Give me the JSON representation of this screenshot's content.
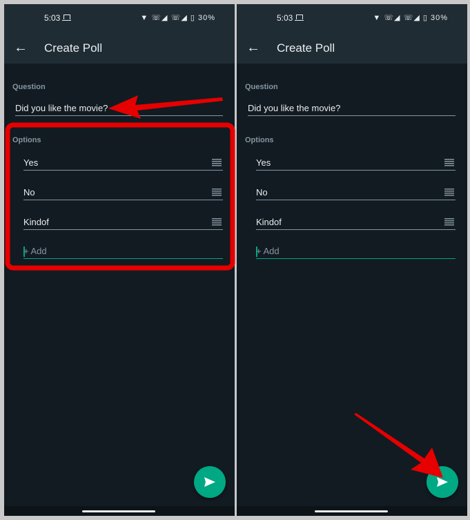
{
  "screens": [
    {
      "status": {
        "time": "5:03",
        "icons": "▼ ☏◢ ☏◢ ▯ ",
        "battery": "30%"
      },
      "header": {
        "title": "Create Poll",
        "back_icon": "arrow-left-icon"
      },
      "question": {
        "label": "Question",
        "value": "Did you like the movie?"
      },
      "options": {
        "label": "Options",
        "items": [
          "Yes",
          "No",
          "Kindof"
        ],
        "add_placeholder": "+ Add"
      },
      "fab": {
        "icon": "send-icon"
      }
    },
    {
      "status": {
        "time": "5:03",
        "icons": "▼ ☏◢ ☏◢ ▯ ",
        "battery": "30%"
      },
      "header": {
        "title": "Create Poll",
        "back_icon": "arrow-left-icon"
      },
      "question": {
        "label": "Question",
        "value": "Did you like the movie?"
      },
      "options": {
        "label": "Options",
        "items": [
          "Yes",
          "No",
          "Kindof"
        ],
        "add_placeholder": "+ Add"
      },
      "fab": {
        "icon": "send-icon"
      }
    }
  ],
  "colors": {
    "header": "#1f2c34",
    "background": "#121b22",
    "accent": "#00a884",
    "annotation": "#e60000"
  }
}
